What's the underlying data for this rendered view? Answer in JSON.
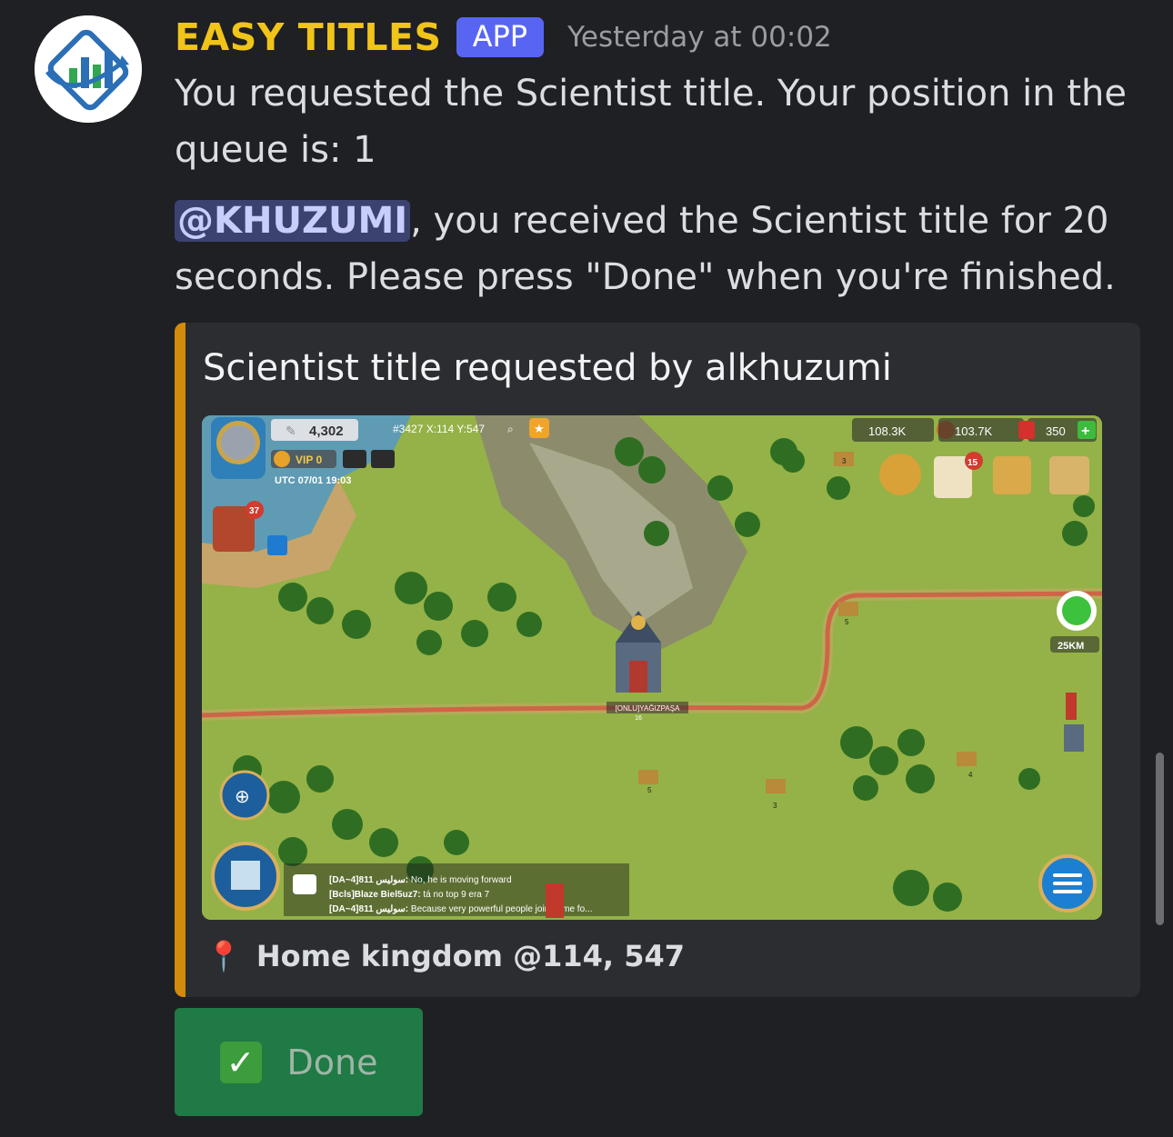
{
  "message": {
    "author": "EASY TITLES",
    "badge": "APP",
    "timestamp": "Yesterday at 00:02",
    "line1": "You requested the Scientist title. Your position in the queue is: 1",
    "mention": "@KHUZUMI",
    "line2": ", you received the Scientist title for 20 seconds. Please press \"Done\" when you're finished."
  },
  "embed": {
    "accent_color": "#d48a0a",
    "title": "Scientist title requested by alkhuzumi",
    "footer_icon": "pin-icon",
    "footer": "Home kingdom @114, 547",
    "game": {
      "power": "4,302",
      "coords": "#3427 X:114 Y:547",
      "vip": "VIP 0",
      "time": "UTC 07/01 19:03",
      "mail_count": "37",
      "food": "108.3K",
      "wood": "103.7K",
      "gems": "350",
      "quest_badge": "15",
      "distance": "25KM",
      "city_name": "[ONLU]YAĞIZPAŞA",
      "city_level": "16",
      "node_levels": [
        "3",
        "5",
        "5",
        "3",
        "4"
      ],
      "chat": [
        {
          "who": "[DA~4]سوليس 811:",
          "text": " No, he is moving forward"
        },
        {
          "who": "[Bcls]Blaze Biel5uz7:",
          "text": " tá no top 9 era 7"
        },
        {
          "who": "[DA~4]سوليس 811:",
          "text": " Because very powerful people joined me fo..."
        }
      ]
    }
  },
  "button": {
    "icon": "check-icon",
    "label": "Done",
    "color": "#1f7a45"
  }
}
